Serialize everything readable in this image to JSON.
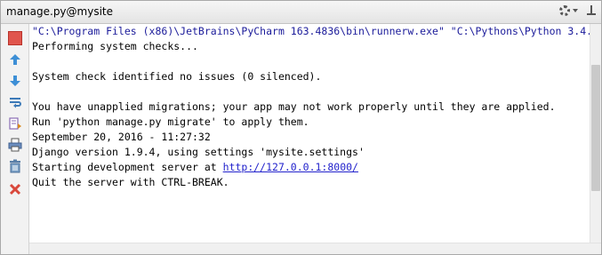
{
  "window": {
    "title": "manage.py@mysite"
  },
  "toolbar": {
    "icons": [
      "settings-icon",
      "chevron-down-icon",
      "hide-icon"
    ]
  },
  "sidebar": {
    "tools": [
      "stop-icon",
      "up-arrow-icon",
      "down-arrow-icon",
      "soft-wrap-icon",
      "scroll-to-end-icon",
      "print-icon",
      "trash-icon",
      "close-icon"
    ]
  },
  "console": {
    "line1": "\"C:\\Program Files (x86)\\JetBrains\\PyCharm 163.4836\\bin\\runnerw.exe\" \"C:\\Pythons\\Python 3.4.",
    "line2": "Performing system checks...",
    "line3": "",
    "line4": "System check identified no issues (0 silenced).",
    "line5": "",
    "line6": "You have unapplied migrations; your app may not work properly until they are applied.",
    "line7": "Run 'python manage.py migrate' to apply them.",
    "line8": "September 20, 2016 - 11:27:32",
    "line9": "Django version 1.9.4, using settings 'mysite.settings'",
    "line10_prefix": "Starting development server at ",
    "line10_link": "http://127.0.0.1:8000/",
    "line11": "Quit the server with CTRL-BREAK."
  },
  "colors": {
    "command_text": "#1b1b9a",
    "link": "#2222cc",
    "stop": "#e0554d"
  }
}
